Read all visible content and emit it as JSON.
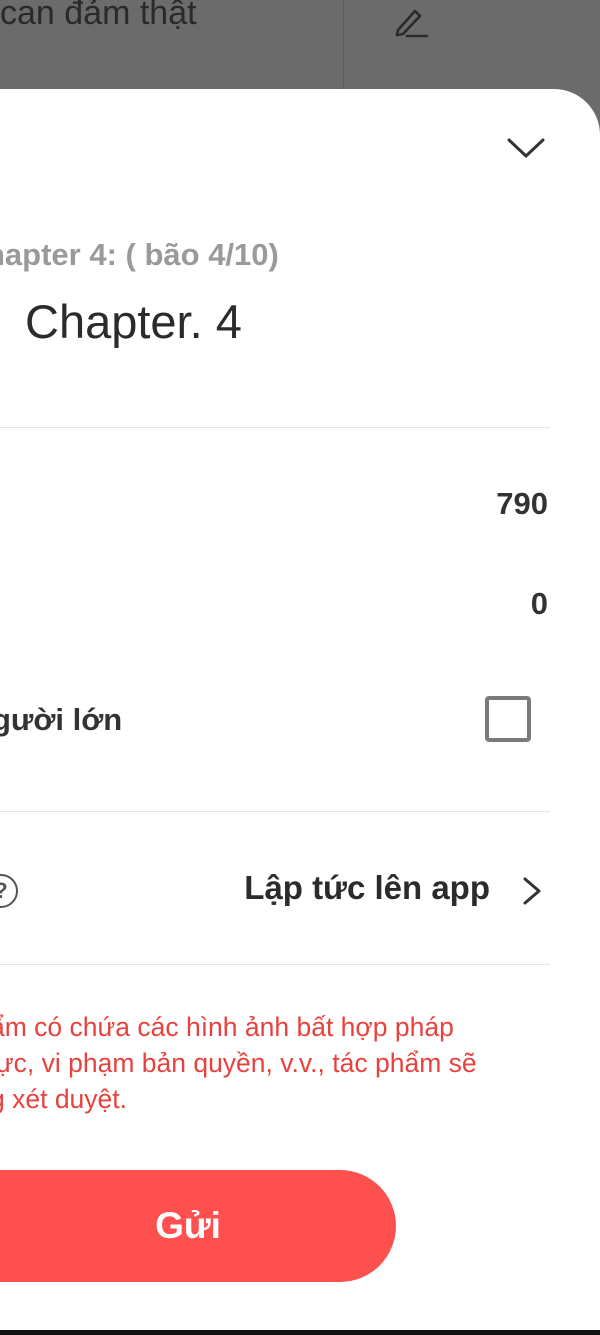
{
  "background": {
    "title_fragment": "can đảm thật",
    "edit_icon": "pencil-icon"
  },
  "sheet": {
    "collapse_icon": "chevron-down-icon",
    "chapter_subtitle": "hapter 4: ( bão 4/10)",
    "chapter_title": "Chapter. 4",
    "stats": {
      "value_1": "790",
      "value_2": "0"
    },
    "adult_label": "gười lớn",
    "adult_checked": false,
    "help_icon_glyph": "?",
    "publish_option": "Lập tức lên app",
    "warning_lines": [
      "ẩm có chứa các hình ảnh bất hợp pháp",
      " lực, vi phạm bản quyền, v.v., tác phẩm sẽ",
      "g xét duyệt."
    ],
    "send_label": "Gửi"
  },
  "colors": {
    "accent": "#ff5050",
    "warning": "#e8423e",
    "backdrop": "#6b6b6b"
  }
}
